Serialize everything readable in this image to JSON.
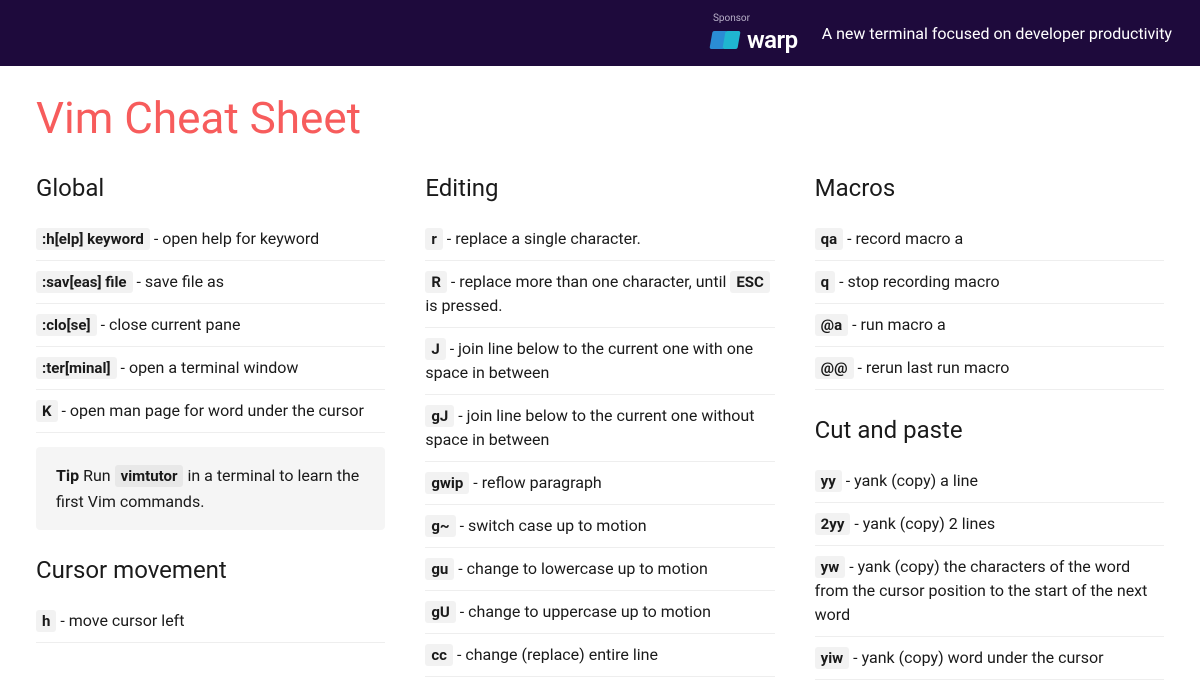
{
  "sponsor": {
    "label": "Sponsor",
    "brand": "warp",
    "tagline": "A new terminal focused on developer productivity"
  },
  "title": "Vim Cheat Sheet",
  "columns": {
    "global": {
      "heading": "Global",
      "items": [
        {
          "key": ":h[elp] keyword",
          "desc": "open help for keyword"
        },
        {
          "key": ":sav[eas] file",
          "desc": "save file as"
        },
        {
          "key": ":clo[se]",
          "desc": "close current pane"
        },
        {
          "key": ":ter[minal]",
          "desc": "open a terminal window"
        },
        {
          "key": "K",
          "desc": "open man page for word under the cursor"
        }
      ],
      "tip": {
        "label": "Tip",
        "text_before": "Run ",
        "code": "vimtutor",
        "text_after": " in a terminal to learn the first Vim commands."
      }
    },
    "cursor": {
      "heading": "Cursor movement",
      "items": [
        {
          "key": "h",
          "desc": "move cursor left"
        }
      ]
    },
    "editing": {
      "heading": "Editing",
      "items": [
        {
          "key": "r",
          "desc": "replace a single character."
        },
        {
          "key": "R",
          "desc": "replace more than one character, until ",
          "key2": "ESC",
          "desc2": " is pressed."
        },
        {
          "key": "J",
          "desc": "join line below to the current one with one space in between"
        },
        {
          "key": "gJ",
          "desc": "join line below to the current one without space in between"
        },
        {
          "key": "gwip",
          "desc": "reflow paragraph"
        },
        {
          "key": "g~",
          "desc": "switch case up to motion"
        },
        {
          "key": "gu",
          "desc": "change to lowercase up to motion"
        },
        {
          "key": "gU",
          "desc": "change to uppercase up to motion"
        },
        {
          "key": "cc",
          "desc": "change (replace) entire line"
        }
      ]
    },
    "macros": {
      "heading": "Macros",
      "items": [
        {
          "key": "qa",
          "desc": "record macro a"
        },
        {
          "key": "q",
          "desc": "stop recording macro"
        },
        {
          "key": "@a",
          "desc": "run macro a"
        },
        {
          "key": "@@",
          "desc": "rerun last run macro"
        }
      ]
    },
    "cutpaste": {
      "heading": "Cut and paste",
      "items": [
        {
          "key": "yy",
          "desc": "yank (copy) a line"
        },
        {
          "key": "2yy",
          "desc": "yank (copy) 2 lines"
        },
        {
          "key": "yw",
          "desc": "yank (copy) the characters of the word from the cursor position to the start of the next word"
        },
        {
          "key": "yiw",
          "desc": "yank (copy) word under the cursor"
        }
      ]
    }
  }
}
